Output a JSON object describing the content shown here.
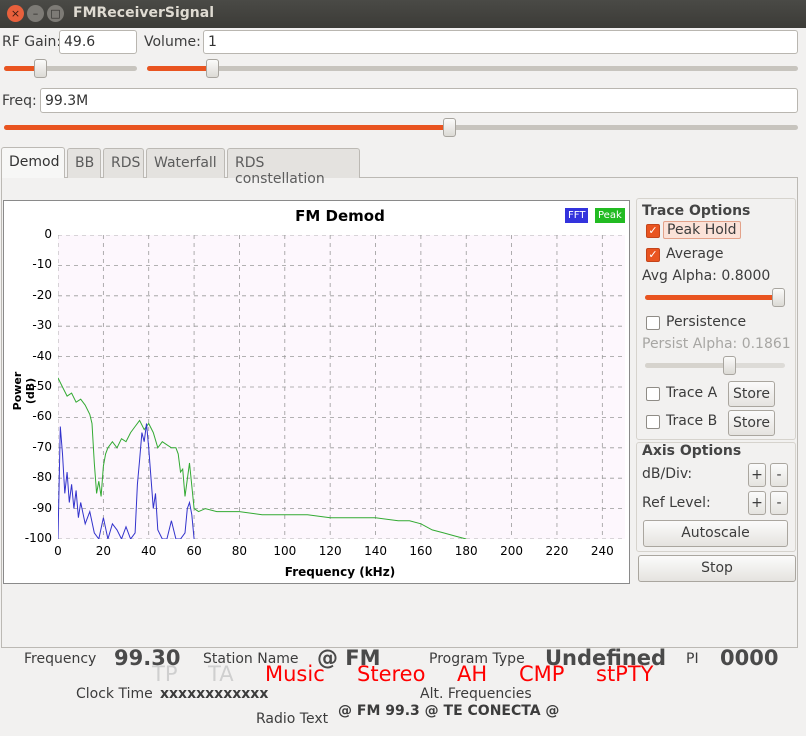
{
  "window": {
    "title": "FMReceiverSignal"
  },
  "controls": {
    "rf_gain": {
      "label": "RF Gain:",
      "value": "49.6",
      "fraction": 0.27
    },
    "volume": {
      "label": "Volume:",
      "value": "1",
      "fraction": 0.1
    },
    "freq": {
      "label": "Freq:",
      "value": "99.3M",
      "fraction": 0.56
    }
  },
  "tabs": [
    "Demod",
    "BB",
    "RDS",
    "Waterfall",
    "RDS constellation"
  ],
  "active_tab": "Demod",
  "trace_options": {
    "heading": "Trace Options",
    "peak_hold": {
      "label": "Peak Hold",
      "checked": true
    },
    "average": {
      "label": "Average",
      "checked": true
    },
    "avg_alpha": "Avg Alpha: 0.8000",
    "avg_alpha_fraction": 0.95,
    "persistence": {
      "label": "Persistence",
      "checked": false
    },
    "persist_alpha": "Persist Alpha: 0.1861",
    "persist_alpha_fraction": 0.6,
    "trace_a": {
      "label": "Trace A",
      "store": "Store",
      "checked": false
    },
    "trace_b": {
      "label": "Trace B",
      "store": "Store",
      "checked": false
    }
  },
  "axis_options": {
    "heading": "Axis Options",
    "db_div": "dB/Div:",
    "ref_level": "Ref Level:",
    "plus": "+",
    "minus": "-",
    "autoscale": "Autoscale"
  },
  "stop_label": "Stop",
  "chart_data": {
    "type": "line",
    "title": "FM Demod",
    "xlabel": "Frequency (kHz)",
    "ylabel": "Power (dB)",
    "xlim": [
      0,
      250
    ],
    "ylim": [
      -100,
      0
    ],
    "xticks": [
      "0",
      "20",
      "40",
      "60",
      "80",
      "100",
      "120",
      "140",
      "160",
      "180",
      "200",
      "220",
      "240"
    ],
    "yticks": [
      "0",
      "-10",
      "-20",
      "-30",
      "-40",
      "-50",
      "-60",
      "-70",
      "-80",
      "-90",
      "-100"
    ],
    "grid": true,
    "legend": [
      "FFT",
      "Peak"
    ],
    "series": [
      {
        "name": "FFT",
        "color": "#3333cc",
        "x": [
          0,
          1,
          2,
          3,
          4,
          5,
          6,
          7,
          8,
          9,
          10,
          12,
          14,
          16,
          18,
          20,
          22,
          24,
          26,
          28,
          30,
          32,
          34,
          35,
          36,
          37,
          38,
          39,
          40,
          41,
          42,
          43,
          44,
          46,
          48,
          50,
          52,
          54,
          56,
          57,
          58,
          59,
          60
        ],
        "y": [
          -100,
          -63,
          -72,
          -85,
          -78,
          -88,
          -82,
          -90,
          -84,
          -93,
          -88,
          -95,
          -91,
          -98,
          -100,
          -93,
          -100,
          -95,
          -97,
          -100,
          -96,
          -100,
          -98,
          -82,
          -74,
          -65,
          -68,
          -62,
          -70,
          -80,
          -90,
          -85,
          -97,
          -100,
          -100,
          -94,
          -100,
          -100,
          -98,
          -90,
          -88,
          -92,
          -100
        ]
      },
      {
        "name": "Peak",
        "color": "#33aa33",
        "x": [
          0,
          2,
          4,
          6,
          8,
          10,
          12,
          14,
          15,
          16,
          17,
          18,
          19,
          20,
          21,
          22,
          24,
          26,
          28,
          30,
          32,
          34,
          36,
          38,
          40,
          42,
          44,
          46,
          48,
          50,
          52,
          53,
          54,
          55,
          56,
          58,
          60,
          62,
          65,
          70,
          80,
          90,
          100,
          110,
          120,
          130,
          140,
          150,
          155,
          160,
          165,
          170,
          175,
          180
        ],
        "y": [
          -47,
          -50,
          -53,
          -52,
          -55,
          -54,
          -56,
          -59,
          -62,
          -75,
          -85,
          -81,
          -86,
          -76,
          -72,
          -70,
          -68,
          -70,
          -67,
          -68,
          -65,
          -63,
          -61,
          -64,
          -62,
          -65,
          -70,
          -68,
          -69,
          -70,
          -70,
          -72,
          -78,
          -77,
          -86,
          -75,
          -90,
          -91,
          -90,
          -91,
          -91,
          -92,
          -92,
          -92,
          -93,
          -93,
          -93,
          -94,
          -94,
          -95,
          -97,
          -98,
          -99,
          -100
        ]
      }
    ]
  },
  "rds": {
    "frequency_label": "Frequency",
    "frequency_value": "99.30",
    "station_label": "Station Name",
    "station_value": "@ FM",
    "program_label": "Program Type",
    "program_value": "Undefined",
    "pi_label": "PI",
    "pi_value": "0000",
    "flags": [
      {
        "label": "TP",
        "on": false
      },
      {
        "label": "TA",
        "on": false
      },
      {
        "label": "Music",
        "on": true
      },
      {
        "label": "Stereo",
        "on": true
      },
      {
        "label": "AH",
        "on": true
      },
      {
        "label": "CMP",
        "on": true
      },
      {
        "label": "stPTY",
        "on": true
      }
    ],
    "clock_label": "Clock Time",
    "clock_value": "xxxxxxxxxxxx",
    "alt_freq_label": "Alt. Frequencies",
    "radio_text_label": "Radio Text",
    "radio_text_value": "@ FM 99.3 @ TE CONECTA @"
  }
}
